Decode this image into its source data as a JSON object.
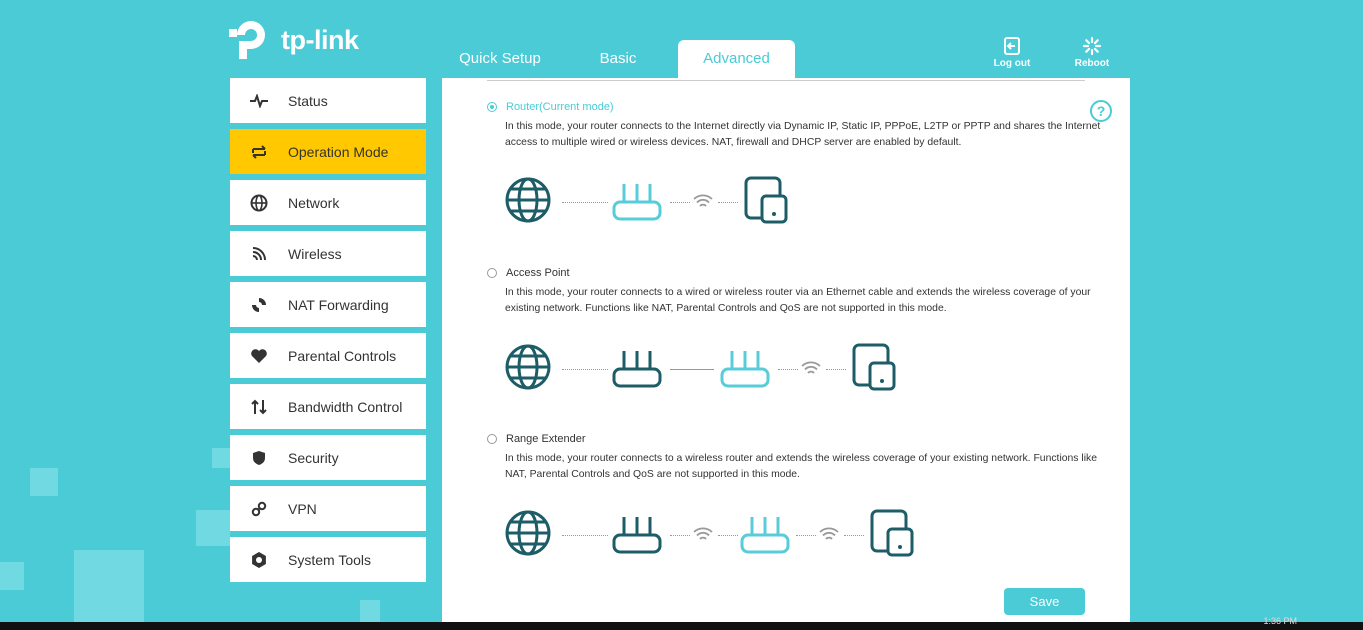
{
  "brand": {
    "name": "tp-link",
    "accent": "#4acbd6",
    "highlight": "#ffc800"
  },
  "nav": {
    "tabs": [
      {
        "label": "Quick Setup"
      },
      {
        "label": "Basic"
      },
      {
        "label": "Advanced",
        "active": true
      }
    ],
    "logout_label": "Log out",
    "reboot_label": "Reboot"
  },
  "sidebar": {
    "items": [
      {
        "label": "Status",
        "icon": "pulse-icon"
      },
      {
        "label": "Operation Mode",
        "icon": "swap-icon",
        "active": true
      },
      {
        "label": "Network",
        "icon": "globe-icon"
      },
      {
        "label": "Wireless",
        "icon": "wifi-icon"
      },
      {
        "label": "NAT Forwarding",
        "icon": "nat-icon"
      },
      {
        "label": "Parental Controls",
        "icon": "heart-icon"
      },
      {
        "label": "Bandwidth Control",
        "icon": "updown-icon"
      },
      {
        "label": "Security",
        "icon": "shield-icon"
      },
      {
        "label": "VPN",
        "icon": "link-icon"
      },
      {
        "label": "System Tools",
        "icon": "gear-icon"
      }
    ]
  },
  "modes": [
    {
      "name": "Router(Current mode)",
      "selected": true,
      "description": "In this mode, your router connects to the Internet directly via Dynamic IP, Static IP, PPPoE, L2TP or PPTP and shares the Internet access to multiple wired or wireless devices. NAT, firewall and DHCP server are enabled by default."
    },
    {
      "name": "Access Point",
      "selected": false,
      "description": "In this mode, your router connects to a wired or wireless router via an Ethernet cable and extends the wireless coverage of your existing network. Functions like NAT, Parental Controls and QoS are not supported in this mode."
    },
    {
      "name": "Range Extender",
      "selected": false,
      "description": "In this mode, your router connects to a wireless router and extends the wireless coverage of your existing network. Functions like NAT, Parental Controls and QoS are not supported in this mode."
    }
  ],
  "save_label": "Save",
  "taskbar": {
    "time": "1:36 PM"
  }
}
